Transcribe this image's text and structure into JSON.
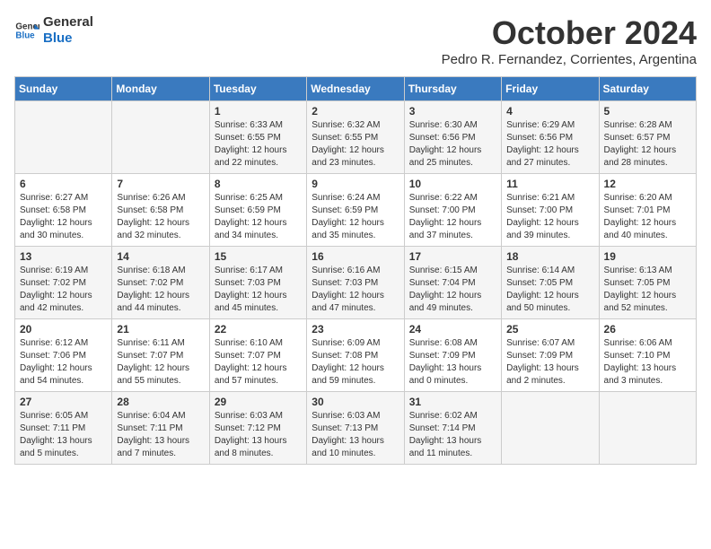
{
  "header": {
    "logo_line1": "General",
    "logo_line2": "Blue",
    "month_title": "October 2024",
    "subtitle": "Pedro R. Fernandez, Corrientes, Argentina"
  },
  "days_of_week": [
    "Sunday",
    "Monday",
    "Tuesday",
    "Wednesday",
    "Thursday",
    "Friday",
    "Saturday"
  ],
  "weeks": [
    [
      {
        "day": "",
        "info": ""
      },
      {
        "day": "",
        "info": ""
      },
      {
        "day": "1",
        "info": "Sunrise: 6:33 AM\nSunset: 6:55 PM\nDaylight: 12 hours and 22 minutes."
      },
      {
        "day": "2",
        "info": "Sunrise: 6:32 AM\nSunset: 6:55 PM\nDaylight: 12 hours and 23 minutes."
      },
      {
        "day": "3",
        "info": "Sunrise: 6:30 AM\nSunset: 6:56 PM\nDaylight: 12 hours and 25 minutes."
      },
      {
        "day": "4",
        "info": "Sunrise: 6:29 AM\nSunset: 6:56 PM\nDaylight: 12 hours and 27 minutes."
      },
      {
        "day": "5",
        "info": "Sunrise: 6:28 AM\nSunset: 6:57 PM\nDaylight: 12 hours and 28 minutes."
      }
    ],
    [
      {
        "day": "6",
        "info": "Sunrise: 6:27 AM\nSunset: 6:58 PM\nDaylight: 12 hours and 30 minutes."
      },
      {
        "day": "7",
        "info": "Sunrise: 6:26 AM\nSunset: 6:58 PM\nDaylight: 12 hours and 32 minutes."
      },
      {
        "day": "8",
        "info": "Sunrise: 6:25 AM\nSunset: 6:59 PM\nDaylight: 12 hours and 34 minutes."
      },
      {
        "day": "9",
        "info": "Sunrise: 6:24 AM\nSunset: 6:59 PM\nDaylight: 12 hours and 35 minutes."
      },
      {
        "day": "10",
        "info": "Sunrise: 6:22 AM\nSunset: 7:00 PM\nDaylight: 12 hours and 37 minutes."
      },
      {
        "day": "11",
        "info": "Sunrise: 6:21 AM\nSunset: 7:00 PM\nDaylight: 12 hours and 39 minutes."
      },
      {
        "day": "12",
        "info": "Sunrise: 6:20 AM\nSunset: 7:01 PM\nDaylight: 12 hours and 40 minutes."
      }
    ],
    [
      {
        "day": "13",
        "info": "Sunrise: 6:19 AM\nSunset: 7:02 PM\nDaylight: 12 hours and 42 minutes."
      },
      {
        "day": "14",
        "info": "Sunrise: 6:18 AM\nSunset: 7:02 PM\nDaylight: 12 hours and 44 minutes."
      },
      {
        "day": "15",
        "info": "Sunrise: 6:17 AM\nSunset: 7:03 PM\nDaylight: 12 hours and 45 minutes."
      },
      {
        "day": "16",
        "info": "Sunrise: 6:16 AM\nSunset: 7:03 PM\nDaylight: 12 hours and 47 minutes."
      },
      {
        "day": "17",
        "info": "Sunrise: 6:15 AM\nSunset: 7:04 PM\nDaylight: 12 hours and 49 minutes."
      },
      {
        "day": "18",
        "info": "Sunrise: 6:14 AM\nSunset: 7:05 PM\nDaylight: 12 hours and 50 minutes."
      },
      {
        "day": "19",
        "info": "Sunrise: 6:13 AM\nSunset: 7:05 PM\nDaylight: 12 hours and 52 minutes."
      }
    ],
    [
      {
        "day": "20",
        "info": "Sunrise: 6:12 AM\nSunset: 7:06 PM\nDaylight: 12 hours and 54 minutes."
      },
      {
        "day": "21",
        "info": "Sunrise: 6:11 AM\nSunset: 7:07 PM\nDaylight: 12 hours and 55 minutes."
      },
      {
        "day": "22",
        "info": "Sunrise: 6:10 AM\nSunset: 7:07 PM\nDaylight: 12 hours and 57 minutes."
      },
      {
        "day": "23",
        "info": "Sunrise: 6:09 AM\nSunset: 7:08 PM\nDaylight: 12 hours and 59 minutes."
      },
      {
        "day": "24",
        "info": "Sunrise: 6:08 AM\nSunset: 7:09 PM\nDaylight: 13 hours and 0 minutes."
      },
      {
        "day": "25",
        "info": "Sunrise: 6:07 AM\nSunset: 7:09 PM\nDaylight: 13 hours and 2 minutes."
      },
      {
        "day": "26",
        "info": "Sunrise: 6:06 AM\nSunset: 7:10 PM\nDaylight: 13 hours and 3 minutes."
      }
    ],
    [
      {
        "day": "27",
        "info": "Sunrise: 6:05 AM\nSunset: 7:11 PM\nDaylight: 13 hours and 5 minutes."
      },
      {
        "day": "28",
        "info": "Sunrise: 6:04 AM\nSunset: 7:11 PM\nDaylight: 13 hours and 7 minutes."
      },
      {
        "day": "29",
        "info": "Sunrise: 6:03 AM\nSunset: 7:12 PM\nDaylight: 13 hours and 8 minutes."
      },
      {
        "day": "30",
        "info": "Sunrise: 6:03 AM\nSunset: 7:13 PM\nDaylight: 13 hours and 10 minutes."
      },
      {
        "day": "31",
        "info": "Sunrise: 6:02 AM\nSunset: 7:14 PM\nDaylight: 13 hours and 11 minutes."
      },
      {
        "day": "",
        "info": ""
      },
      {
        "day": "",
        "info": ""
      }
    ]
  ]
}
